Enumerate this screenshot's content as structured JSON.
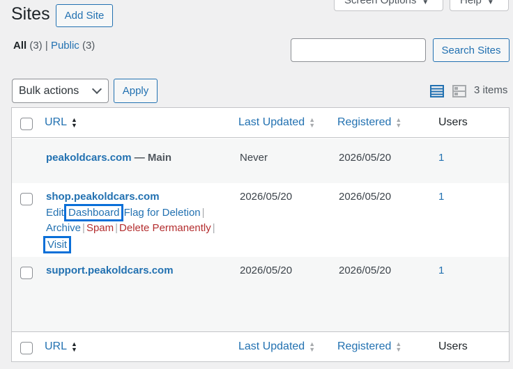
{
  "top_tabs": {
    "screen_options": "Screen Options",
    "help": "Help"
  },
  "title": "Sites",
  "add_site": "Add Site",
  "filters": {
    "all_label": "All",
    "all_count": "(3)",
    "sep": "|",
    "public_label": "Public",
    "public_count": "(3)"
  },
  "search": {
    "button": "Search Sites",
    "value": ""
  },
  "bulk": {
    "selected": "Bulk actions",
    "apply": "Apply"
  },
  "items_count": "3 items",
  "columns": {
    "url": "URL",
    "last_updated": "Last Updated",
    "registered": "Registered",
    "users": "Users"
  },
  "rows": [
    {
      "url": "peakoldcars.com",
      "suffix": " — Main",
      "last_updated": "Never",
      "registered": "2026/05/20",
      "users": "1"
    },
    {
      "url": "shop.peakoldcars.com",
      "last_updated": "2026/05/20",
      "registered": "2026/05/20",
      "users": "1",
      "actions": {
        "edit": "Edit",
        "dashboard": "Dashboard",
        "flag": "Flag for Deletion",
        "archive": "Archive",
        "spam": "Spam",
        "delete": "Delete Permanently",
        "visit": "Visit",
        "sep": "|"
      }
    },
    {
      "url": "support.peakoldcars.com",
      "last_updated": "2026/05/20",
      "registered": "2026/05/20",
      "users": "1"
    }
  ],
  "colors": {
    "link": "#2271b1",
    "danger": "#b32d2e",
    "highlight": "#0a6fd8"
  }
}
